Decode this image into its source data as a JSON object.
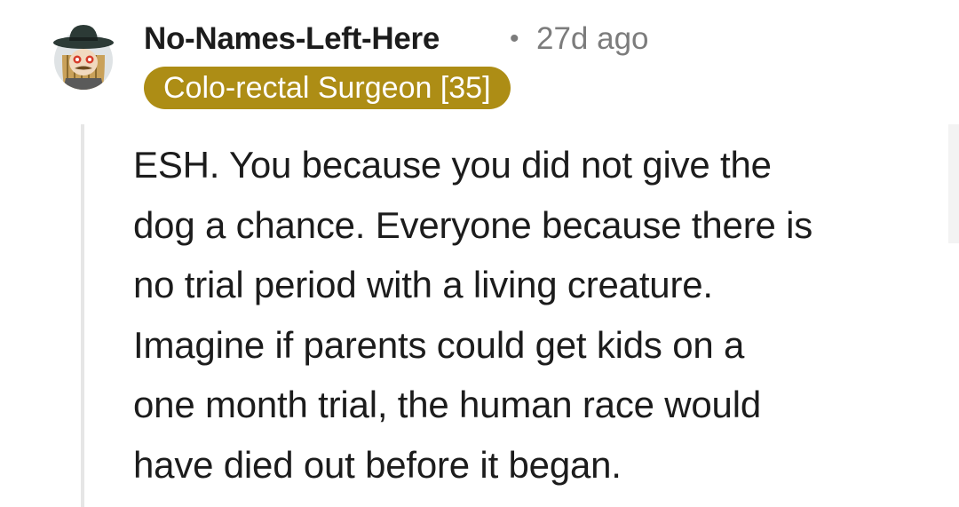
{
  "comment": {
    "author": "No-Names-Left-Here",
    "separator": "•",
    "timestamp": "27d ago",
    "flair": "Colo-rectal Surgeon [35]",
    "avatar_icon": "snoo-avatar-icon",
    "flair_color": "#ad8d15",
    "body_lines": [
      "ESH. You because you did not give the",
      "dog a chance. Everyone because there is",
      "no trial period with a living creature.",
      "Imagine if parents could get kids on a",
      "one month trial, the human race would",
      "have died out before it began."
    ]
  }
}
